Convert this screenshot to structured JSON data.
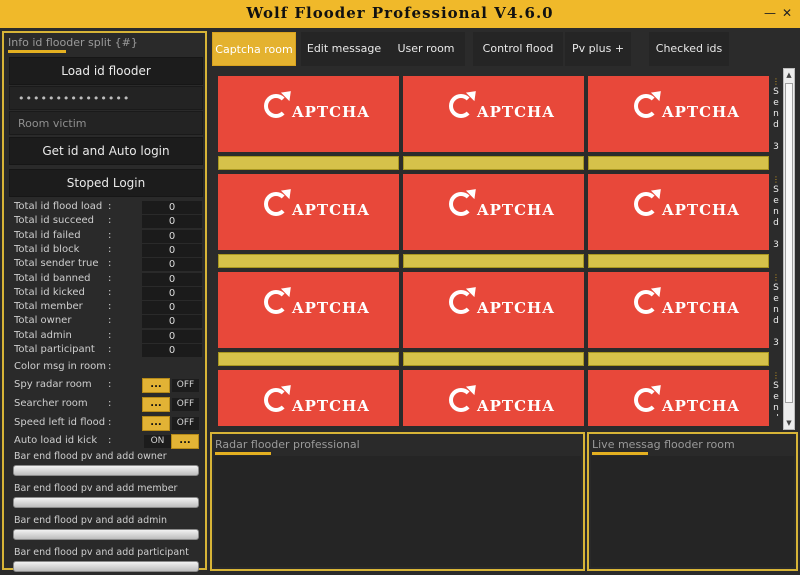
{
  "window": {
    "title": "Wolf Flooder Professional V4.6.0",
    "minimize_glyph": "—",
    "close_glyph": "✕"
  },
  "left_panel": {
    "title": "Info id flooder split {#}",
    "load_button": "Load id flooder",
    "password_value": "•••••••••••••••",
    "room_placeholder": "Room victim",
    "auto_login_button": "Get id and Auto login",
    "stop_login_button": "Stoped Login",
    "stats": [
      {
        "label": "Total id flood load",
        "value": "0"
      },
      {
        "label": "Total id succeed",
        "value": "0"
      },
      {
        "label": "Total id failed",
        "value": "0"
      },
      {
        "label": "Total id block",
        "value": "0"
      },
      {
        "label": "Total sender true",
        "value": "0"
      },
      {
        "label": "Total id banned",
        "value": "0"
      },
      {
        "label": "Total id kicked",
        "value": "0"
      },
      {
        "label": "Total  member",
        "value": "0"
      },
      {
        "label": "Total  owner",
        "value": "0"
      },
      {
        "label": "Total  admin",
        "value": "0"
      },
      {
        "label": "Total  participant",
        "value": "0"
      }
    ],
    "color_msg_label": "Color msg in room",
    "options": [
      {
        "label": "Spy radar room",
        "dots": "...",
        "toggle": "OFF"
      },
      {
        "label": "Searcher room",
        "dots": "...",
        "toggle": "OFF"
      },
      {
        "label": "Speed left id flood",
        "dots": "...",
        "toggle": "OFF"
      },
      {
        "label": "Auto load id kick",
        "dots": "...",
        "toggle": "ON"
      }
    ],
    "bars": [
      {
        "label": "Bar end flood  pv and add owner"
      },
      {
        "label": "Bar end flood  pv and add member"
      },
      {
        "label": "Bar end flood  pv and add admin"
      },
      {
        "label": "Bar end flood  pv and add participant"
      }
    ]
  },
  "tabs": [
    {
      "label": "Captcha room",
      "active": true
    },
    {
      "label": "Edit message",
      "active": false
    },
    {
      "label": "User room",
      "active": false
    },
    {
      "label": "Control flood",
      "active": false
    },
    {
      "label": "Pv plus +",
      "active": false
    },
    {
      "label": "Checked ids",
      "active": false
    }
  ],
  "captcha_grid": {
    "image_text": "APTCHA",
    "send_label": "Send",
    "send_count": "3",
    "rows": 4,
    "cols": 3
  },
  "bottom_panels": {
    "radar_title": "Radar flooder professional",
    "live_title": "Live messag flooder room"
  },
  "colors": {
    "accent": "#e4b22f",
    "captcha_bg": "#e8483a",
    "answer_field": "#d6c24a",
    "bg": "#2b2b2b"
  }
}
